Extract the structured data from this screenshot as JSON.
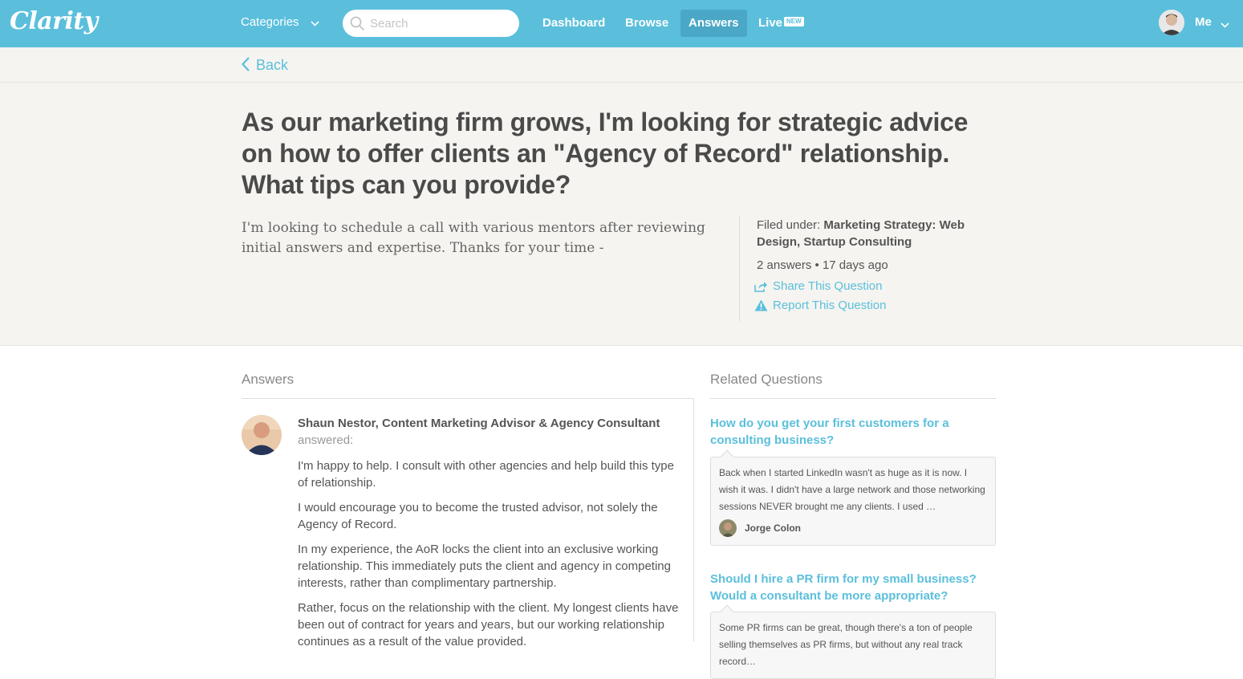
{
  "nav": {
    "logo": "Clarity",
    "categories_label": "Categories",
    "search_placeholder": "Search",
    "links": [
      "Dashboard",
      "Browse",
      "Answers",
      "Live"
    ],
    "active_link": "Answers",
    "new_badge": "NEW",
    "me_label": "Me"
  },
  "backbar": {
    "back_label": "Back"
  },
  "question": {
    "title": "As our marketing firm grows, I'm looking for strategic advice on how to offer clients an \"Agency of Record\" relationship. What tips can you provide?",
    "body": "I'm looking to schedule a call with various mentors after reviewing initial answers and expertise. Thanks for your time -",
    "filed_prefix": "Filed under: ",
    "filed_categories": "Marketing Strategy: Web Design, Startup Consulting",
    "meta": "2 answers • 17 days ago",
    "share_label": "Share This Question",
    "report_label": "Report This Question"
  },
  "answers": {
    "heading": "Answers",
    "items": [
      {
        "author": "Shaun Nestor, Content Marketing Advisor & Agency Consultant",
        "answered": "answered:",
        "paragraphs": [
          "I'm happy to help. I consult with other agencies and help build this type of relationship.",
          "I would encourage you to become the trusted advisor, not solely the Agency of Record.",
          "In my experience, the AoR locks the client into an exclusive working relationship. This immediately puts the client and agency in competing interests, rather than complimentary partnership.",
          "Rather, focus on the relationship with the client. My longest clients have been out of contract for years and years, but our working relationship continues as a result of the value provided."
        ]
      }
    ]
  },
  "related": {
    "heading": "Related Questions",
    "items": [
      {
        "title": "How do you get your first customers for a consulting business?",
        "snippet": "Back when I started LinkedIn wasn't as huge as it is now. I wish it was. I didn't have a large network and those networking sessions NEVER brought me any clients. I used …",
        "user": "Jorge Colon"
      },
      {
        "title": "Should I hire a PR firm for my small business? Would a consultant be more appropriate?",
        "snippet": "Some PR firms can be great, though there's a ton of people selling themselves as PR firms, but without any real track record…",
        "user": ""
      }
    ]
  },
  "colors": {
    "brand": "#5bbfdc",
    "brand_dark": "#4aa8c6",
    "hero_bg": "#f5f4f0"
  }
}
